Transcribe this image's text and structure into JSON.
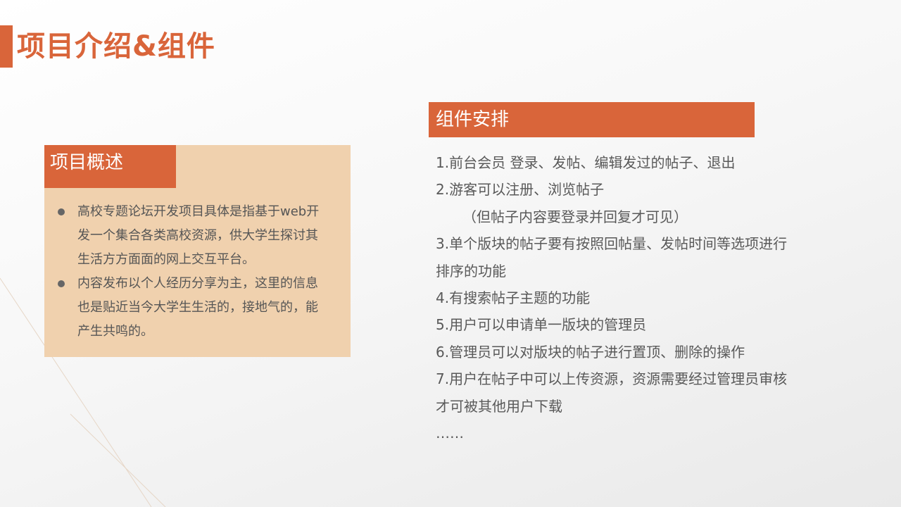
{
  "page": {
    "title": "项目介绍&组件"
  },
  "overview": {
    "heading": "项目概述",
    "bullets": [
      {
        "lines": [
          "高校专题论坛开发项目具体是指基于web开",
          "发一个集合各类高校资源，供大学生探讨其",
          "生活方方面面的网上交互平台。"
        ]
      },
      {
        "lines": [
          "内容发布以个人经历分享为主，这里的信息",
          "也是贴近当今大学生生活的，接地气的，能",
          "产生共鸣的。"
        ]
      }
    ]
  },
  "components": {
    "heading": "组件安排",
    "lines": [
      "1.前台会员  登录、发帖、编辑发过的帖子、退出",
      "2.游客可以注册、浏览帖子",
      "（但帖子内容要登录并回复才可见）",
      "3.单个版块的帖子要有按照回帖量、发帖时间等选项进行",
      "排序的功能",
      "4.有搜索帖子主题的功能",
      "5.用户可以申请单一版块的管理员",
      "6.管理员可以对版块的帖子进行置顶、删除的操作",
      "7.用户在帖子中可以上传资源，资源需要经过管理员审核",
      "才可被其他用户下载",
      "……"
    ]
  },
  "colors": {
    "accent": "#d9653a",
    "panel": "#f0d1ae",
    "text": "#595959"
  }
}
